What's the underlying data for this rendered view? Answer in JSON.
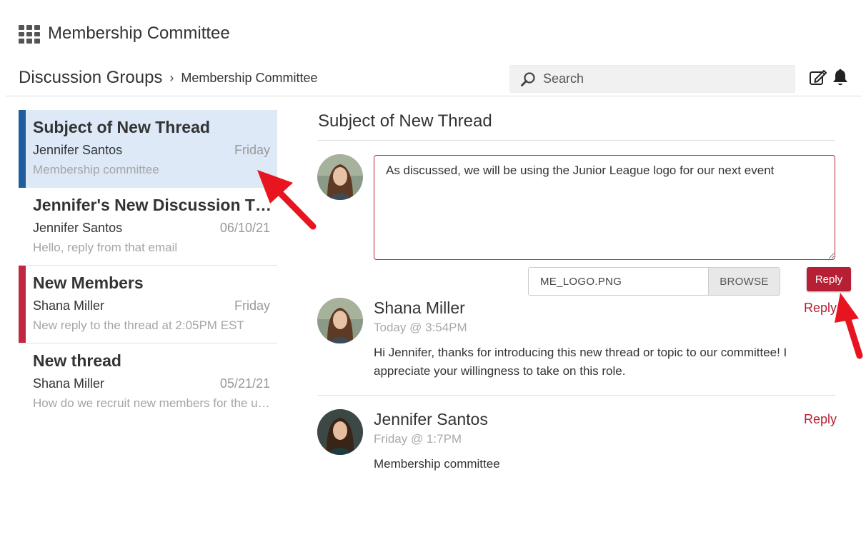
{
  "app": {
    "title": "Membership Committee",
    "menu_icon": "grid-icon"
  },
  "breadcrumb": {
    "root": "Discussion Groups",
    "separator": "›",
    "current": "Membership Committee"
  },
  "search": {
    "placeholder": "Search",
    "value": ""
  },
  "header_icons": [
    "compose-icon",
    "bell-icon"
  ],
  "threads": [
    {
      "subject": "Subject of New Thread",
      "author": "Jennifer Santos",
      "date": "Friday",
      "preview": "Membership committee",
      "active": true,
      "accent": "#1f5e9e"
    },
    {
      "subject": "Jennifer's New Discussion Thread",
      "author": "Jennifer Santos",
      "date": "06/10/21",
      "preview": "Hello, reply from that email",
      "active": false,
      "accent": ""
    },
    {
      "subject": "New Members",
      "author": "Shana Miller",
      "date": "Friday",
      "preview": "New reply to the thread at 2:05PM EST",
      "active": false,
      "accent": "#c0283f"
    },
    {
      "subject": "New thread",
      "author": "Shana Miller",
      "date": "05/21/21",
      "preview": "How do we recruit new members for the upcoming year?",
      "active": false,
      "accent": ""
    }
  ],
  "main": {
    "title": "Subject of New Thread",
    "compose": {
      "value": "As discussed, we will be using the Junior League logo for our next event"
    },
    "attachment": {
      "file_name": "ME_LOGO.PNG",
      "browse_label": "BROWSE"
    },
    "reply_button": "Reply",
    "messages": [
      {
        "author": "Shana Miller",
        "time": "Today @ 3:54PM",
        "body": "Hi Jennifer, thanks for introducing this new thread or topic to our committee! I appreciate your willingness to take on this role.",
        "reply_label": "Reply"
      },
      {
        "author": "Jennifer Santos",
        "time": "Friday @ 1:7PM",
        "body": "Membership committee",
        "reply_label": "Reply"
      }
    ]
  },
  "colors": {
    "accent_red": "#b72034",
    "active_bg": "#dde9f7",
    "active_bar": "#1f5e9e"
  }
}
